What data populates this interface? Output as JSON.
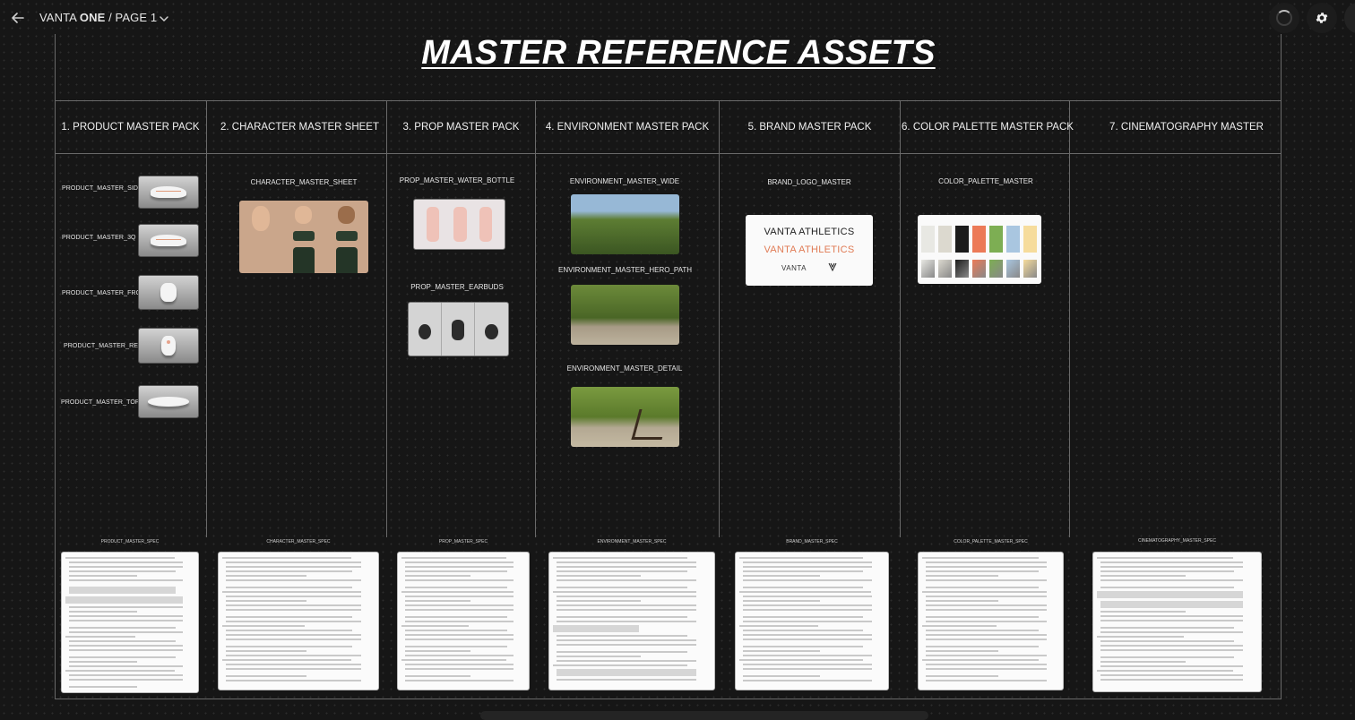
{
  "topbar": {
    "brand_regular": "VANTA ",
    "brand_bold": "ONE",
    "page_path": " / PAGE 1"
  },
  "board": {
    "title": "MASTER REFERENCE ASSETS",
    "columns": [
      "1. PRODUCT MASTER PACK",
      "2. CHARACTER MASTER SHEET",
      "3. PROP MASTER PACK",
      "4. ENVIRONMENT MASTER PACK",
      "5. BRAND MASTER PACK",
      "6. COLOR PALETTE MASTER PACK",
      "7. CINEMATOGRAPHY MASTER"
    ]
  },
  "product": {
    "items": [
      "PRODUCT_MASTER_SIDE",
      "PRODUCT_MASTER_3Q",
      "PRODUCT_MASTER_FRONT",
      "PRODUCT_MASTER_REAR",
      "PRODUCT_MASTER_TOP"
    ]
  },
  "character": {
    "label": "CHARACTER_MASTER_SHEET"
  },
  "props": {
    "bottle_label": "PROP_MASTER_WATER_BOTTLE",
    "earbuds_label": "PROP_MASTER_EARBUDS"
  },
  "environment": {
    "wide_label": "ENVIRONMENT_MASTER_WIDE",
    "hero_label": "ENVIRONMENT_MASTER_HERO_PATH",
    "detail_label": "ENVIRONMENT_MASTER_DETAIL"
  },
  "brand": {
    "label": "BRAND_LOGO_MASTER",
    "line1": "VANTA ATHLETICS",
    "line2": "VANTA ATHLETICS",
    "line3": "VANTA",
    "accent_color": "#e07b55"
  },
  "palette": {
    "label": "COLOR_PALETTE_MASTER",
    "swatches": [
      "#e8e8e3",
      "#dcd9cf",
      "#1b1b1b",
      "#ec7a57",
      "#7dae53",
      "#a9c6e0",
      "#f6dc9c"
    ]
  },
  "specs": [
    "PRODUCT_MASTER_SPEC",
    "CHARACTER_MASTER_SPEC",
    "PROP_MASTER_SPEC",
    "ENVIRONMENT_MASTER_SPEC",
    "BRAND_MASTER_SPEC",
    "COLOR_PALETTE_MASTER_SPEC",
    "CINEMATOGRAPHY_MASTER_SPEC"
  ]
}
